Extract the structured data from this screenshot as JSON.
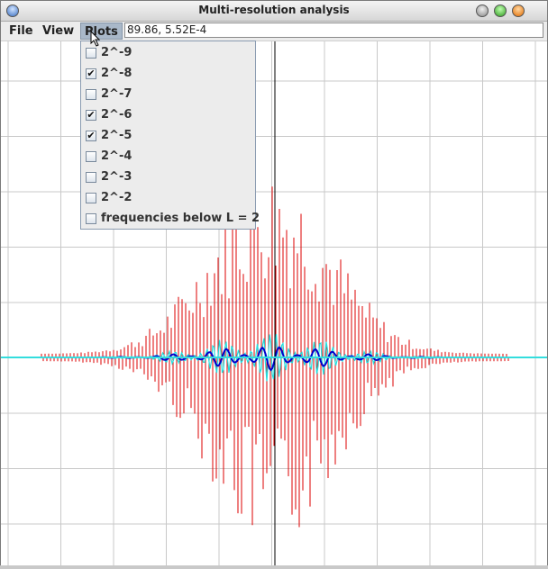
{
  "window": {
    "title": "Multi-resolution analysis"
  },
  "menubar": {
    "file": "File",
    "view": "View",
    "plots": "Plots"
  },
  "coordinate_readout": "89.86, 5.52E-4",
  "plots_menu": {
    "items": [
      {
        "label": "2^-9",
        "checked": false
      },
      {
        "label": "2^-8",
        "checked": true
      },
      {
        "label": "2^-7",
        "checked": false
      },
      {
        "label": "2^-6",
        "checked": true
      },
      {
        "label": "2^-5",
        "checked": true
      },
      {
        "label": "2^-4",
        "checked": false
      },
      {
        "label": "2^-3",
        "checked": false
      },
      {
        "label": "2^-2",
        "checked": false
      },
      {
        "label": "frequencies below L = 2",
        "checked": false
      }
    ]
  },
  "colors": {
    "series_red": "#dd0000",
    "series_cyan": "#22dddd",
    "series_blue": "#0000cc",
    "grid": "#c8c8c8",
    "cursor_line": "#000000"
  },
  "icons": {
    "window_menu": "window-menu-icon",
    "minimize": "minimize-icon",
    "maximize": "maximize-icon",
    "close": "close-icon",
    "pointer": "mouse-pointer-icon"
  }
}
